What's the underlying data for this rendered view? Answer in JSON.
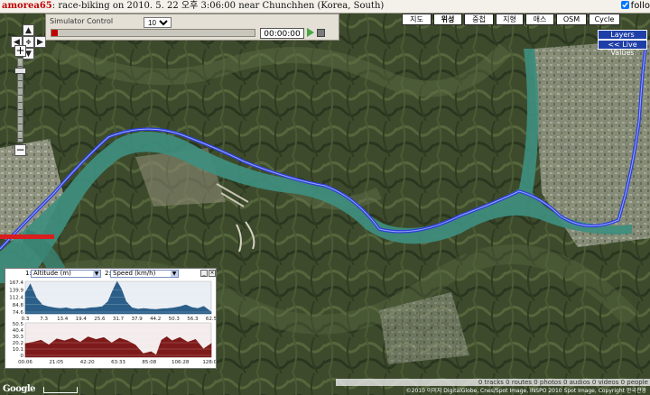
{
  "header": {
    "username": "amorea65",
    "description": ": race-biking on 2010. 5. 22 오후 3:06:00 near Chunchhen (Korea, South)",
    "follow_label": "follo"
  },
  "simulator": {
    "title": "Simulator Control",
    "speed": "10x",
    "time": "00:00:00"
  },
  "map_types": [
    "지도",
    "위성",
    "중첩",
    "지형",
    "애스",
    "OSM",
    "Cycle"
  ],
  "active_map_type": "위성",
  "layers_label": "Layers",
  "live_values_label": "<< Live Values",
  "chart_panel": {
    "slot1_number": "1:",
    "slot1_select": "Altitude (m)",
    "slot2_number": "2:",
    "slot2_select": "Speed (km/h)"
  },
  "chart_data": [
    {
      "type": "area",
      "ylabel": "Altitude (m)",
      "xlabel": "distance",
      "x_ticks": [
        "0.3",
        "7.3",
        "13.4",
        "19.4",
        "25.6",
        "31.7",
        "37.9",
        "44.2",
        "50.3",
        "56.3",
        "62.5"
      ],
      "y_ticks": [
        "167.4",
        "139.9",
        "112.4",
        "84.8",
        "74.6"
      ],
      "x": [
        0.3,
        2,
        4,
        6,
        8,
        10,
        12,
        14,
        16,
        18,
        20,
        22,
        24,
        26,
        28,
        29.5,
        31,
        32.5,
        34,
        36,
        38,
        40,
        42,
        44,
        46,
        48,
        50,
        52,
        54,
        56,
        58,
        60,
        62.5
      ],
      "values": [
        135,
        160,
        120,
        100,
        95,
        92,
        90,
        92,
        88,
        90,
        89,
        92,
        93,
        95,
        110,
        140,
        170,
        145,
        110,
        92,
        88,
        90,
        88,
        87,
        89,
        90,
        92,
        95,
        100,
        93,
        90,
        96,
        80
      ],
      "color": "#2b5f89",
      "ylim": [
        74.6,
        167.4
      ],
      "xlim": [
        0.3,
        62.5
      ]
    },
    {
      "type": "area",
      "ylabel": "Speed (km/h)",
      "xlabel": "time",
      "x_ticks": [
        "00:06",
        "21:05",
        "42:20",
        "63:33",
        "85:08",
        "106:28",
        "128:02"
      ],
      "y_ticks": [
        "50.5",
        "40.4",
        "30.3",
        "20.2",
        "10.1",
        "0"
      ],
      "x": [
        0,
        6,
        12,
        18,
        24,
        30,
        36,
        42,
        48,
        54,
        60,
        66,
        72,
        78,
        84,
        90,
        96,
        100,
        104,
        108,
        112,
        118,
        124,
        130,
        136,
        142
      ],
      "values": [
        20,
        22,
        25,
        18,
        27,
        24,
        28,
        22,
        30,
        26,
        29,
        21,
        28,
        24,
        18,
        5,
        8,
        3,
        25,
        30,
        24,
        29,
        22,
        26,
        12,
        20
      ],
      "color": "#7e1a1a",
      "ylim": [
        0,
        50.5
      ]
    }
  ],
  "status_text": "0 tracks 0 routes 0 photos 0 audios 0 videos 0 people",
  "copyright": "©2010 이미지 DigitalGlobe, Cnes/Spot Image, INSPO 2010 Spot Image, Copyright 한국관광",
  "logo_text": "Google"
}
